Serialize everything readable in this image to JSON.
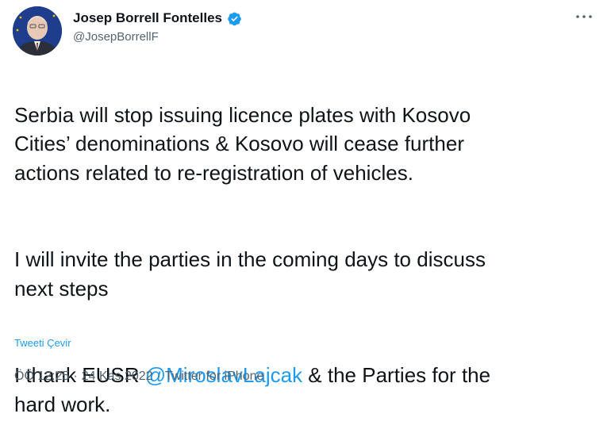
{
  "author": {
    "display_name": "Josep Borrell Fontelles",
    "handle": "@JosepBorrellF",
    "verified": true
  },
  "tweet": {
    "paragraph_1": "Serbia will stop issuing licence plates with Kosovo\nCities’ denominations & Kosovo will cease further\nactions related to re-registration of vehicles.",
    "paragraph_2": "I will invite the parties in the coming days to discuss\nnext steps",
    "paragraph_3_prefix": "I thank EUSR ",
    "paragraph_3_mention": "@MiroslavLajcak",
    "paragraph_3_suffix": " & the Parties for the\nhard work."
  },
  "translate_label": "Tweeti Çevir",
  "meta": {
    "time": "ÖÖ 12:25",
    "separator": "·",
    "date": "24 Kas 2022",
    "source": "Twitter for iPhone"
  },
  "icons": {
    "verified": "verified-badge-icon",
    "more": "more-options-icon"
  },
  "colors": {
    "link": "#1d9bf0",
    "secondary_text": "#536471",
    "primary_text": "#0f1419"
  }
}
